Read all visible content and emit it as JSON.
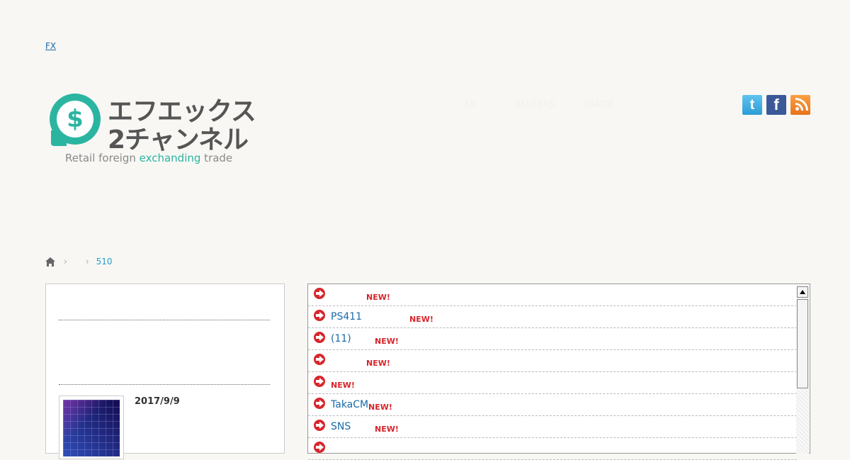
{
  "header": {
    "top_link": "FX",
    "logo": {
      "line1": "エフエックス",
      "line2": "2チャンネル",
      "tagline_a": "Retail foreign ",
      "tagline_hl": "exchanding",
      "tagline_b": " trade"
    },
    "nav": [
      "FX",
      "REUTERS",
      "OANDA"
    ],
    "social": [
      {
        "name": "twitter",
        "icon": "twitter-icon",
        "glyph": "t"
      },
      {
        "name": "facebook",
        "icon": "facebook-icon",
        "glyph": "f"
      },
      {
        "name": "rss",
        "icon": "rss-icon"
      }
    ]
  },
  "breadcrumb": {
    "home_icon": "home-icon",
    "sep1": "›",
    "sep2": "›",
    "current": "510"
  },
  "sidebar": {
    "post_date": "2017/9/9"
  },
  "feed": {
    "new_label": "NEW!",
    "items": [
      {
        "title": ""
      },
      {
        "title": "PS411"
      },
      {
        "title": "(11)"
      },
      {
        "title": ""
      },
      {
        "title": ""
      },
      {
        "title": "TakaCM"
      },
      {
        "title": "SNS"
      },
      {
        "title": ""
      }
    ]
  },
  "colors": {
    "accent_teal": "#2bb5a1",
    "link_blue": "#1a6aa8",
    "new_red": "#d7262c",
    "background": "#f8f7f4"
  }
}
